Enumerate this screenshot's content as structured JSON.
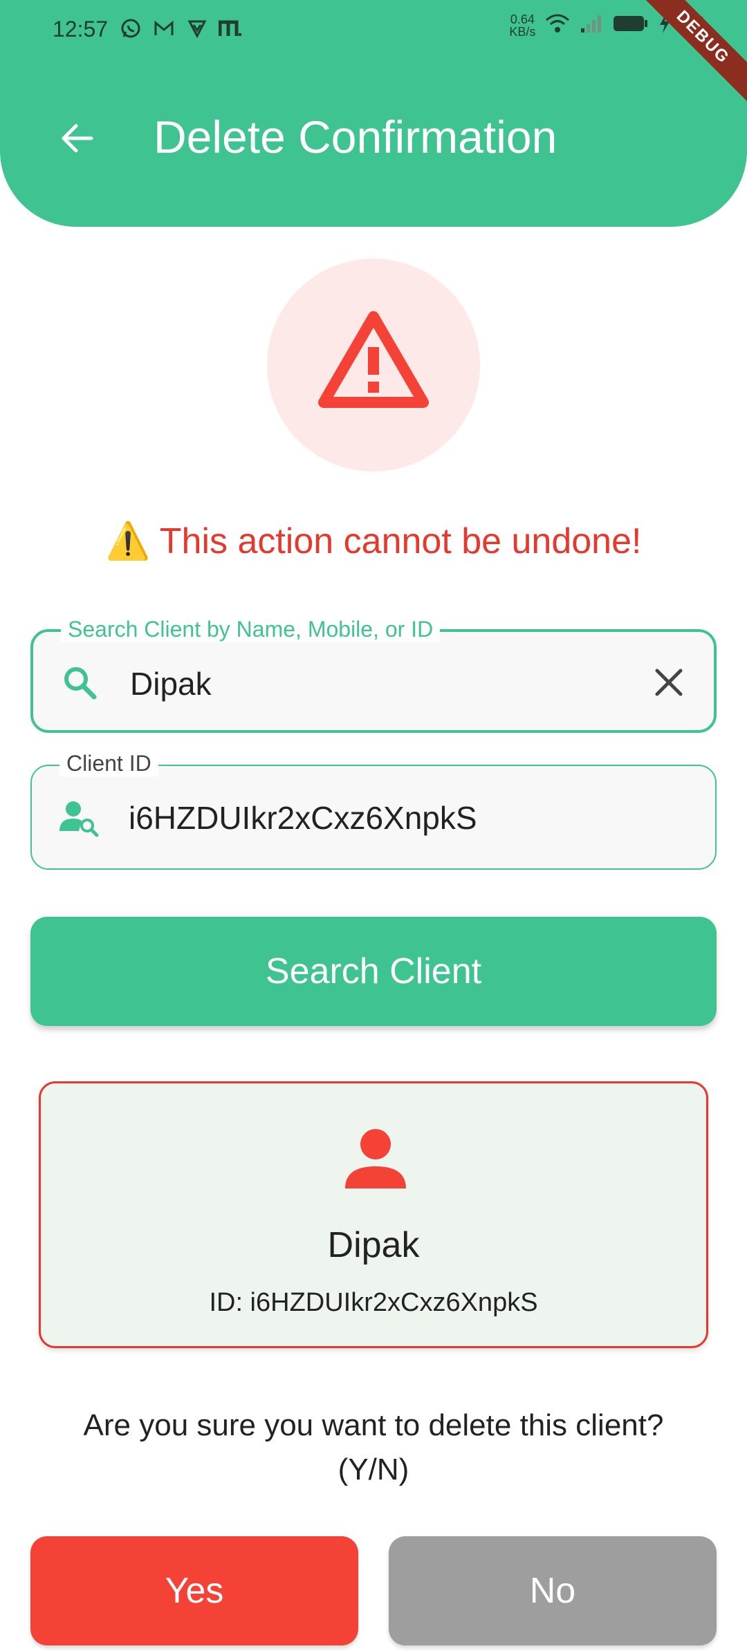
{
  "status_bar": {
    "time": "12:57",
    "net_speed_value": "0.64",
    "net_speed_unit": "KB/s",
    "battery": "84"
  },
  "debug_banner": "DEBUG",
  "header": {
    "title": "Delete Confirmation"
  },
  "warning": {
    "text": "⚠️ This action cannot be undone!"
  },
  "search_field": {
    "label": "Search Client by Name, Mobile, or ID",
    "value": "Dipak"
  },
  "client_id_field": {
    "label": "Client ID",
    "value": "i6HZDUIkr2xCxz6XnpkS"
  },
  "search_button": {
    "label": "Search Client"
  },
  "client_card": {
    "name": "Dipak",
    "id_text": "ID: i6HZDUIkr2xCxz6XnpkS"
  },
  "confirm": {
    "question_line1": "Are you sure you want to delete this client?",
    "question_line2": "(Y/N)"
  },
  "buttons": {
    "yes": "Yes",
    "no": "No"
  },
  "colors": {
    "primary": "#3fc391",
    "danger": "#f44336",
    "warning_text": "#e5392e",
    "neutral": "#9e9e9e"
  }
}
